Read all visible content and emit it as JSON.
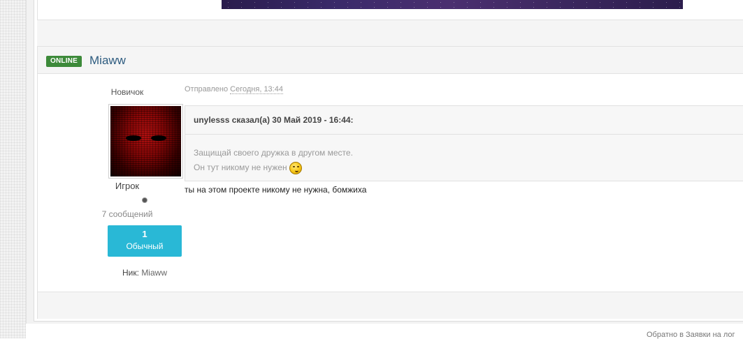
{
  "post": {
    "online_badge": "ONLINE",
    "author_name": "Miaww",
    "group_title": "Новичок",
    "rank": "Игрок",
    "post_count": "7 сообщений",
    "reputation": {
      "value": "1",
      "label": "Обычный"
    },
    "nick_label": "Ник:",
    "nick_value": "Miaww",
    "posted_prefix": "Отправлено",
    "posted_date": "Сегодня, 13:44",
    "quote": {
      "header": "unylesss сказал(а) 30 Май 2019 - 16:44:",
      "line1": "Защищай своего дружка в другом месте.",
      "line2": "Он тут никому не нужен",
      "emoji_icon": "wink-smiley-icon"
    },
    "text": "ты на этом проекте никому не нужна, бомжиха"
  },
  "footer": {
    "back_link": "Обратно в Заявки на лог"
  },
  "colors": {
    "online_badge": "#3d8a3a",
    "reputation_box": "#29b8d6",
    "author_link": "#2d5b7f"
  }
}
